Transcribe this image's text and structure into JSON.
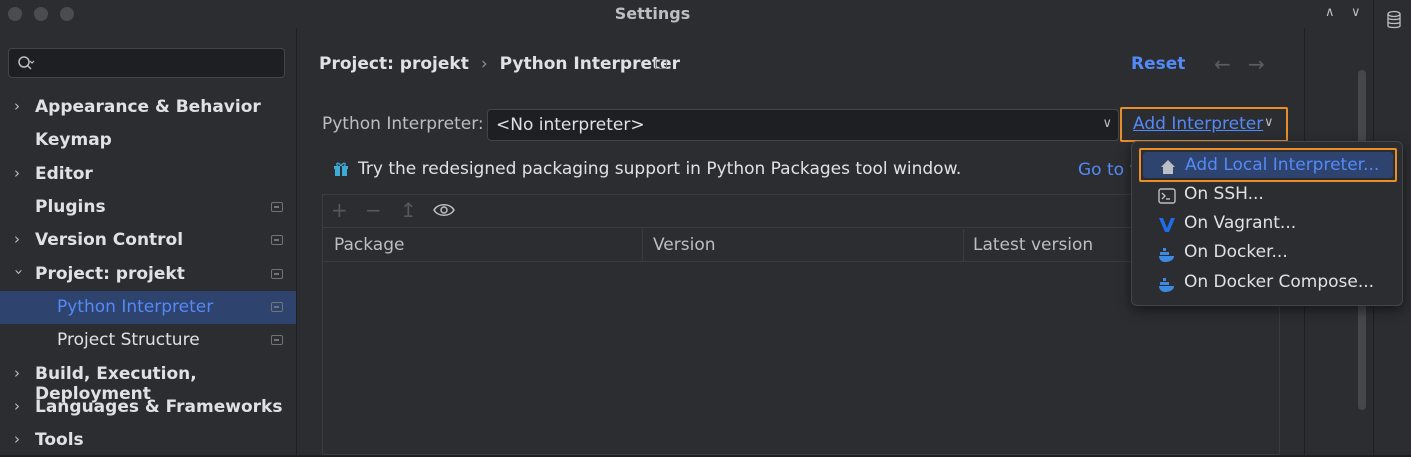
{
  "window": {
    "title": "Settings"
  },
  "sidebar": {
    "search_placeholder": "",
    "items": [
      {
        "label": "Appearance & Behavior",
        "expandable": true,
        "expanded": false,
        "pinned": false
      },
      {
        "label": "Keymap",
        "expandable": false,
        "pinned": false
      },
      {
        "label": "Editor",
        "expandable": true,
        "expanded": false,
        "pinned": false
      },
      {
        "label": "Plugins",
        "expandable": false,
        "pinned": true
      },
      {
        "label": "Version Control",
        "expandable": true,
        "expanded": false,
        "pinned": true
      },
      {
        "label": "Project: projekt",
        "expandable": true,
        "expanded": true,
        "pinned": true
      },
      {
        "label": "Python Interpreter",
        "sub": true,
        "selected": true,
        "pinned": true
      },
      {
        "label": "Project Structure",
        "sub": true,
        "pinned": true
      },
      {
        "label": "Build, Execution, Deployment",
        "expandable": true,
        "expanded": false
      },
      {
        "label": "Languages & Frameworks",
        "expandable": true,
        "expanded": false
      },
      {
        "label": "Tools",
        "expandable": true,
        "expanded": false
      }
    ]
  },
  "header": {
    "breadcrumb_parent": "Project: projekt",
    "breadcrumb_sep": "›",
    "breadcrumb_current": "Python Interpreter",
    "reset_label": "Reset",
    "back_arrow": "←",
    "forward_arrow": "→"
  },
  "interpreter": {
    "label": "Python Interpreter:",
    "value": "<No interpreter>",
    "add_label": "Add Interpreter"
  },
  "banner": {
    "text": "Try the redesigned packaging support in Python Packages tool window.",
    "link": "Go to t"
  },
  "packages": {
    "toolbar": [
      "+",
      "−",
      "↥"
    ],
    "columns": [
      "Package",
      "Version",
      "Latest version"
    ]
  },
  "add_menu": {
    "items": [
      {
        "label": "Add Local Interpreter...",
        "icon": "home-icon",
        "highlighted": true
      },
      {
        "label": "On SSH...",
        "icon": "terminal-icon"
      },
      {
        "label": "On Vagrant...",
        "icon": "vagrant-icon"
      },
      {
        "label": "On Docker...",
        "icon": "docker-icon"
      },
      {
        "label": "On Docker Compose...",
        "icon": "docker-icon"
      }
    ]
  },
  "colors": {
    "accent": "#548af7",
    "highlight_border": "#e88f2c",
    "selection_bg": "#2e436e",
    "panel_bg": "#2b2d30"
  }
}
